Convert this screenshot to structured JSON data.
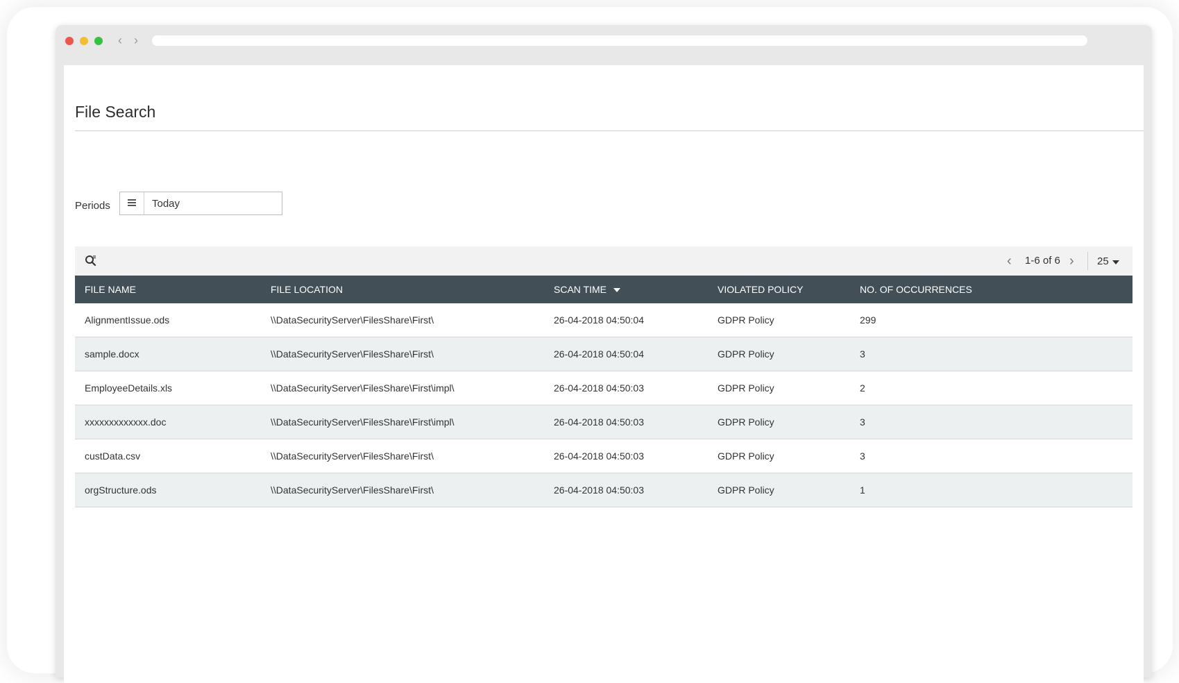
{
  "page": {
    "title": "File Search",
    "periods_label": "Periods",
    "period_value": "Today"
  },
  "toolbar": {
    "search_icon": "search-icon",
    "pagination": "1-6 of 6",
    "page_size": "25"
  },
  "table": {
    "columns": [
      "FILE NAME",
      "FILE LOCATION",
      "SCAN TIME",
      "VIOLATED POLICY",
      "NO. OF OCCURRENCES"
    ],
    "sorted_column": "SCAN TIME",
    "rows": [
      {
        "file_name": "AlignmentIssue.ods",
        "file_location": "\\\\DataSecurityServer\\FilesShare\\First\\",
        "scan_time": "26-04-2018 04:50:04",
        "violated_policy": "GDPR Policy",
        "occurrences": "299"
      },
      {
        "file_name": "sample.docx",
        "file_location": "\\\\DataSecurityServer\\FilesShare\\First\\",
        "scan_time": "26-04-2018 04:50:04",
        "violated_policy": "GDPR Policy",
        "occurrences": "3"
      },
      {
        "file_name": "EmployeeDetails.xls",
        "file_location": "\\\\DataSecurityServer\\FilesShare\\First\\impl\\",
        "scan_time": "26-04-2018 04:50:03",
        "violated_policy": "GDPR Policy",
        "occurrences": "2"
      },
      {
        "file_name": "xxxxxxxxxxxxx.doc",
        "file_location": "\\\\DataSecurityServer\\FilesShare\\First\\impl\\",
        "scan_time": "26-04-2018 04:50:03",
        "violated_policy": "GDPR Policy",
        "occurrences": "3"
      },
      {
        "file_name": "custData.csv",
        "file_location": "\\\\DataSecurityServer\\FilesShare\\First\\",
        "scan_time": "26-04-2018 04:50:03",
        "violated_policy": "GDPR Policy",
        "occurrences": "3"
      },
      {
        "file_name": "orgStructure.ods",
        "file_location": "\\\\DataSecurityServer\\FilesShare\\First\\",
        "scan_time": "26-04-2018 04:50:03",
        "violated_policy": "GDPR Policy",
        "occurrences": "1"
      }
    ]
  },
  "colors": {
    "header_bg": "#424f57",
    "alt_row_bg": "#edf0f1",
    "toolbar_bg": "#f2f2f2"
  }
}
